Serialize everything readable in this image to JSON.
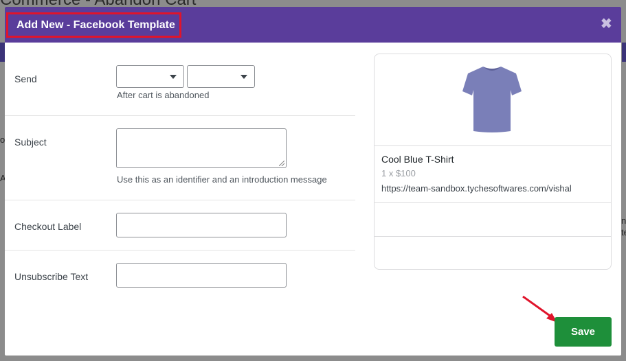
{
  "background": {
    "title": "Commerce - Abandon Cart",
    "fragments": [
      "o",
      "A",
      "n",
      "te"
    ]
  },
  "modal": {
    "title": "Add New - Facebook Template",
    "close_icon": "close-icon"
  },
  "form": {
    "send": {
      "label": "Send",
      "select_1_value": "",
      "select_2_value": "",
      "hint": "After cart is abandoned"
    },
    "subject": {
      "label": "Subject",
      "value": "",
      "hint": "Use this as an identifier and an introduction message"
    },
    "checkout_label": {
      "label": "Checkout Label",
      "value": ""
    },
    "unsubscribe_text": {
      "label": "Unsubscribe Text",
      "value": ""
    }
  },
  "preview": {
    "image_icon": "tshirt-icon",
    "product_name": "Cool Blue T-Shirt",
    "quantity_price": "1 x $100",
    "url": "https://team-sandbox.tychesoftwares.com/vishal"
  },
  "actions": {
    "save_label": "Save"
  },
  "colors": {
    "header": "#5a3d9b",
    "title_highlight": "#e0142b",
    "save": "#1e8f3a",
    "arrow": "#e0142b"
  }
}
